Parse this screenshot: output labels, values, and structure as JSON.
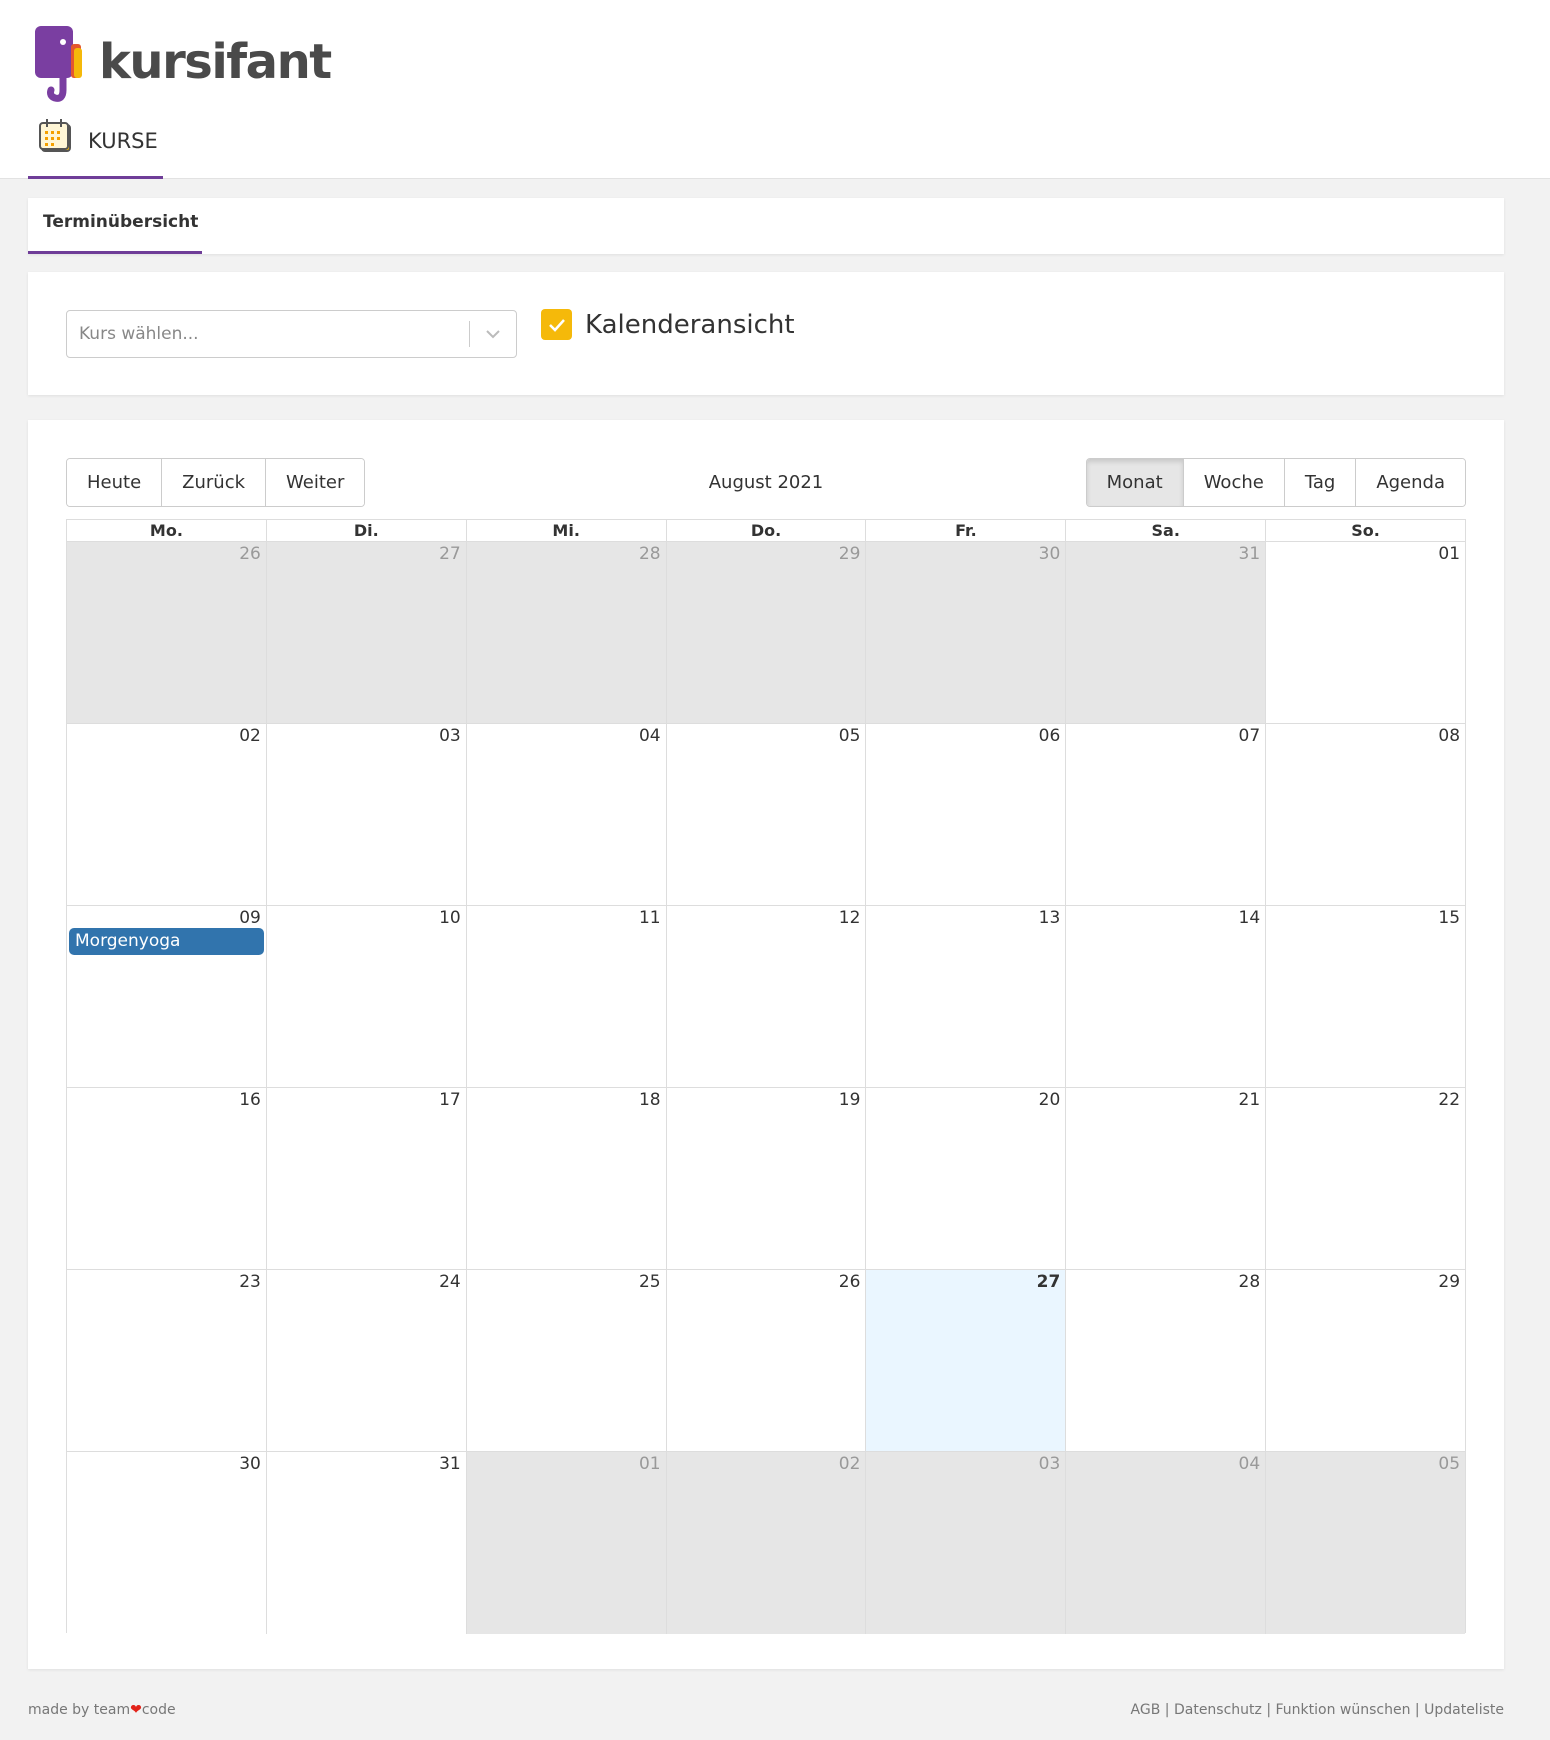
{
  "brand": {
    "name": "kursifant"
  },
  "nav": {
    "tab_label": "KURSE"
  },
  "tabs": [
    {
      "label": "Terminübersicht"
    }
  ],
  "filter": {
    "select_placeholder": "Kurs wählen...",
    "calendar_view_label": "Kalenderansicht",
    "calendar_view_checked": true
  },
  "calendar": {
    "nav_buttons": [
      "Heute",
      "Zurück",
      "Weiter"
    ],
    "title": "August 2021",
    "view_buttons": [
      "Monat",
      "Woche",
      "Tag",
      "Agenda"
    ],
    "active_view": "Monat",
    "weekdays": [
      "Mo.",
      "Di.",
      "Mi.",
      "Do.",
      "Fr.",
      "Sa.",
      "So."
    ],
    "weeks": [
      [
        {
          "d": "26",
          "off": true
        },
        {
          "d": "27",
          "off": true
        },
        {
          "d": "28",
          "off": true
        },
        {
          "d": "29",
          "off": true
        },
        {
          "d": "30",
          "off": true
        },
        {
          "d": "31",
          "off": true
        },
        {
          "d": "01"
        }
      ],
      [
        {
          "d": "02"
        },
        {
          "d": "03"
        },
        {
          "d": "04"
        },
        {
          "d": "05"
        },
        {
          "d": "06"
        },
        {
          "d": "07"
        },
        {
          "d": "08"
        }
      ],
      [
        {
          "d": "09",
          "event": "Morgenyoga"
        },
        {
          "d": "10"
        },
        {
          "d": "11"
        },
        {
          "d": "12"
        },
        {
          "d": "13"
        },
        {
          "d": "14"
        },
        {
          "d": "15"
        }
      ],
      [
        {
          "d": "16"
        },
        {
          "d": "17"
        },
        {
          "d": "18"
        },
        {
          "d": "19"
        },
        {
          "d": "20"
        },
        {
          "d": "21"
        },
        {
          "d": "22"
        }
      ],
      [
        {
          "d": "23"
        },
        {
          "d": "24"
        },
        {
          "d": "25"
        },
        {
          "d": "26"
        },
        {
          "d": "27",
          "today": true
        },
        {
          "d": "28"
        },
        {
          "d": "29"
        }
      ],
      [
        {
          "d": "30"
        },
        {
          "d": "31"
        },
        {
          "d": "01",
          "off": true
        },
        {
          "d": "02",
          "off": true
        },
        {
          "d": "03",
          "off": true
        },
        {
          "d": "04",
          "off": true
        },
        {
          "d": "05",
          "off": true
        }
      ]
    ],
    "colors": {
      "event": "#3174ad",
      "today": "#eaf6ff",
      "off_range": "#e6e6e6"
    }
  },
  "footer": {
    "made_by_prefix": "made by team",
    "made_by_suffix": "code",
    "links": [
      "AGB",
      "Datenschutz",
      "Funktion wünschen",
      "Updateliste"
    ]
  },
  "colors": {
    "accent": "#6f3d98",
    "checkbox": "#f5b90a"
  }
}
